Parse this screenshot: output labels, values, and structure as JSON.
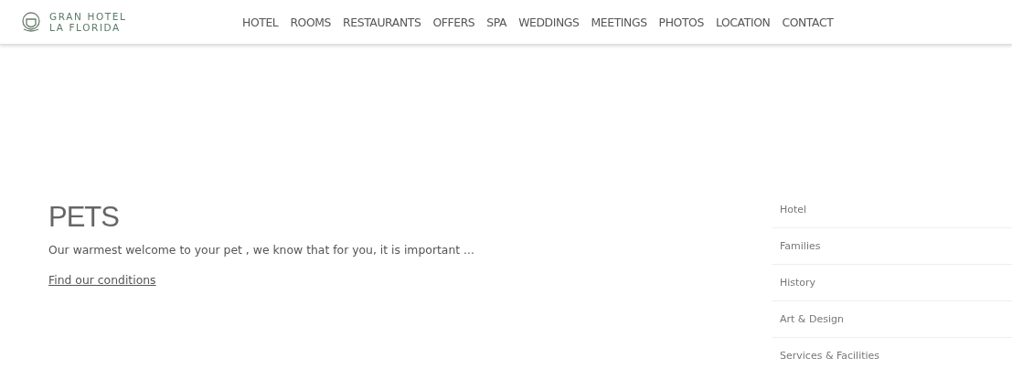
{
  "header": {
    "brand": [
      "GRAN HOTEL",
      "LA FLORIDA"
    ],
    "nav": [
      "HOTEL",
      "ROOMS",
      "RESTAURANTS",
      "OFFERS",
      "SPA",
      "WEDDINGS",
      "MEETINGS",
      "PHOTOS",
      "LOCATION",
      "CONTACT"
    ]
  },
  "main": {
    "title": "PETS",
    "text": "Our warmest welcome to your pet , we know that  for you, it is important ...",
    "link": "Find our conditions"
  },
  "sidebar": {
    "items": [
      "Hotel",
      "Families",
      "History",
      "Art & Design",
      "Services & Facilities"
    ]
  }
}
